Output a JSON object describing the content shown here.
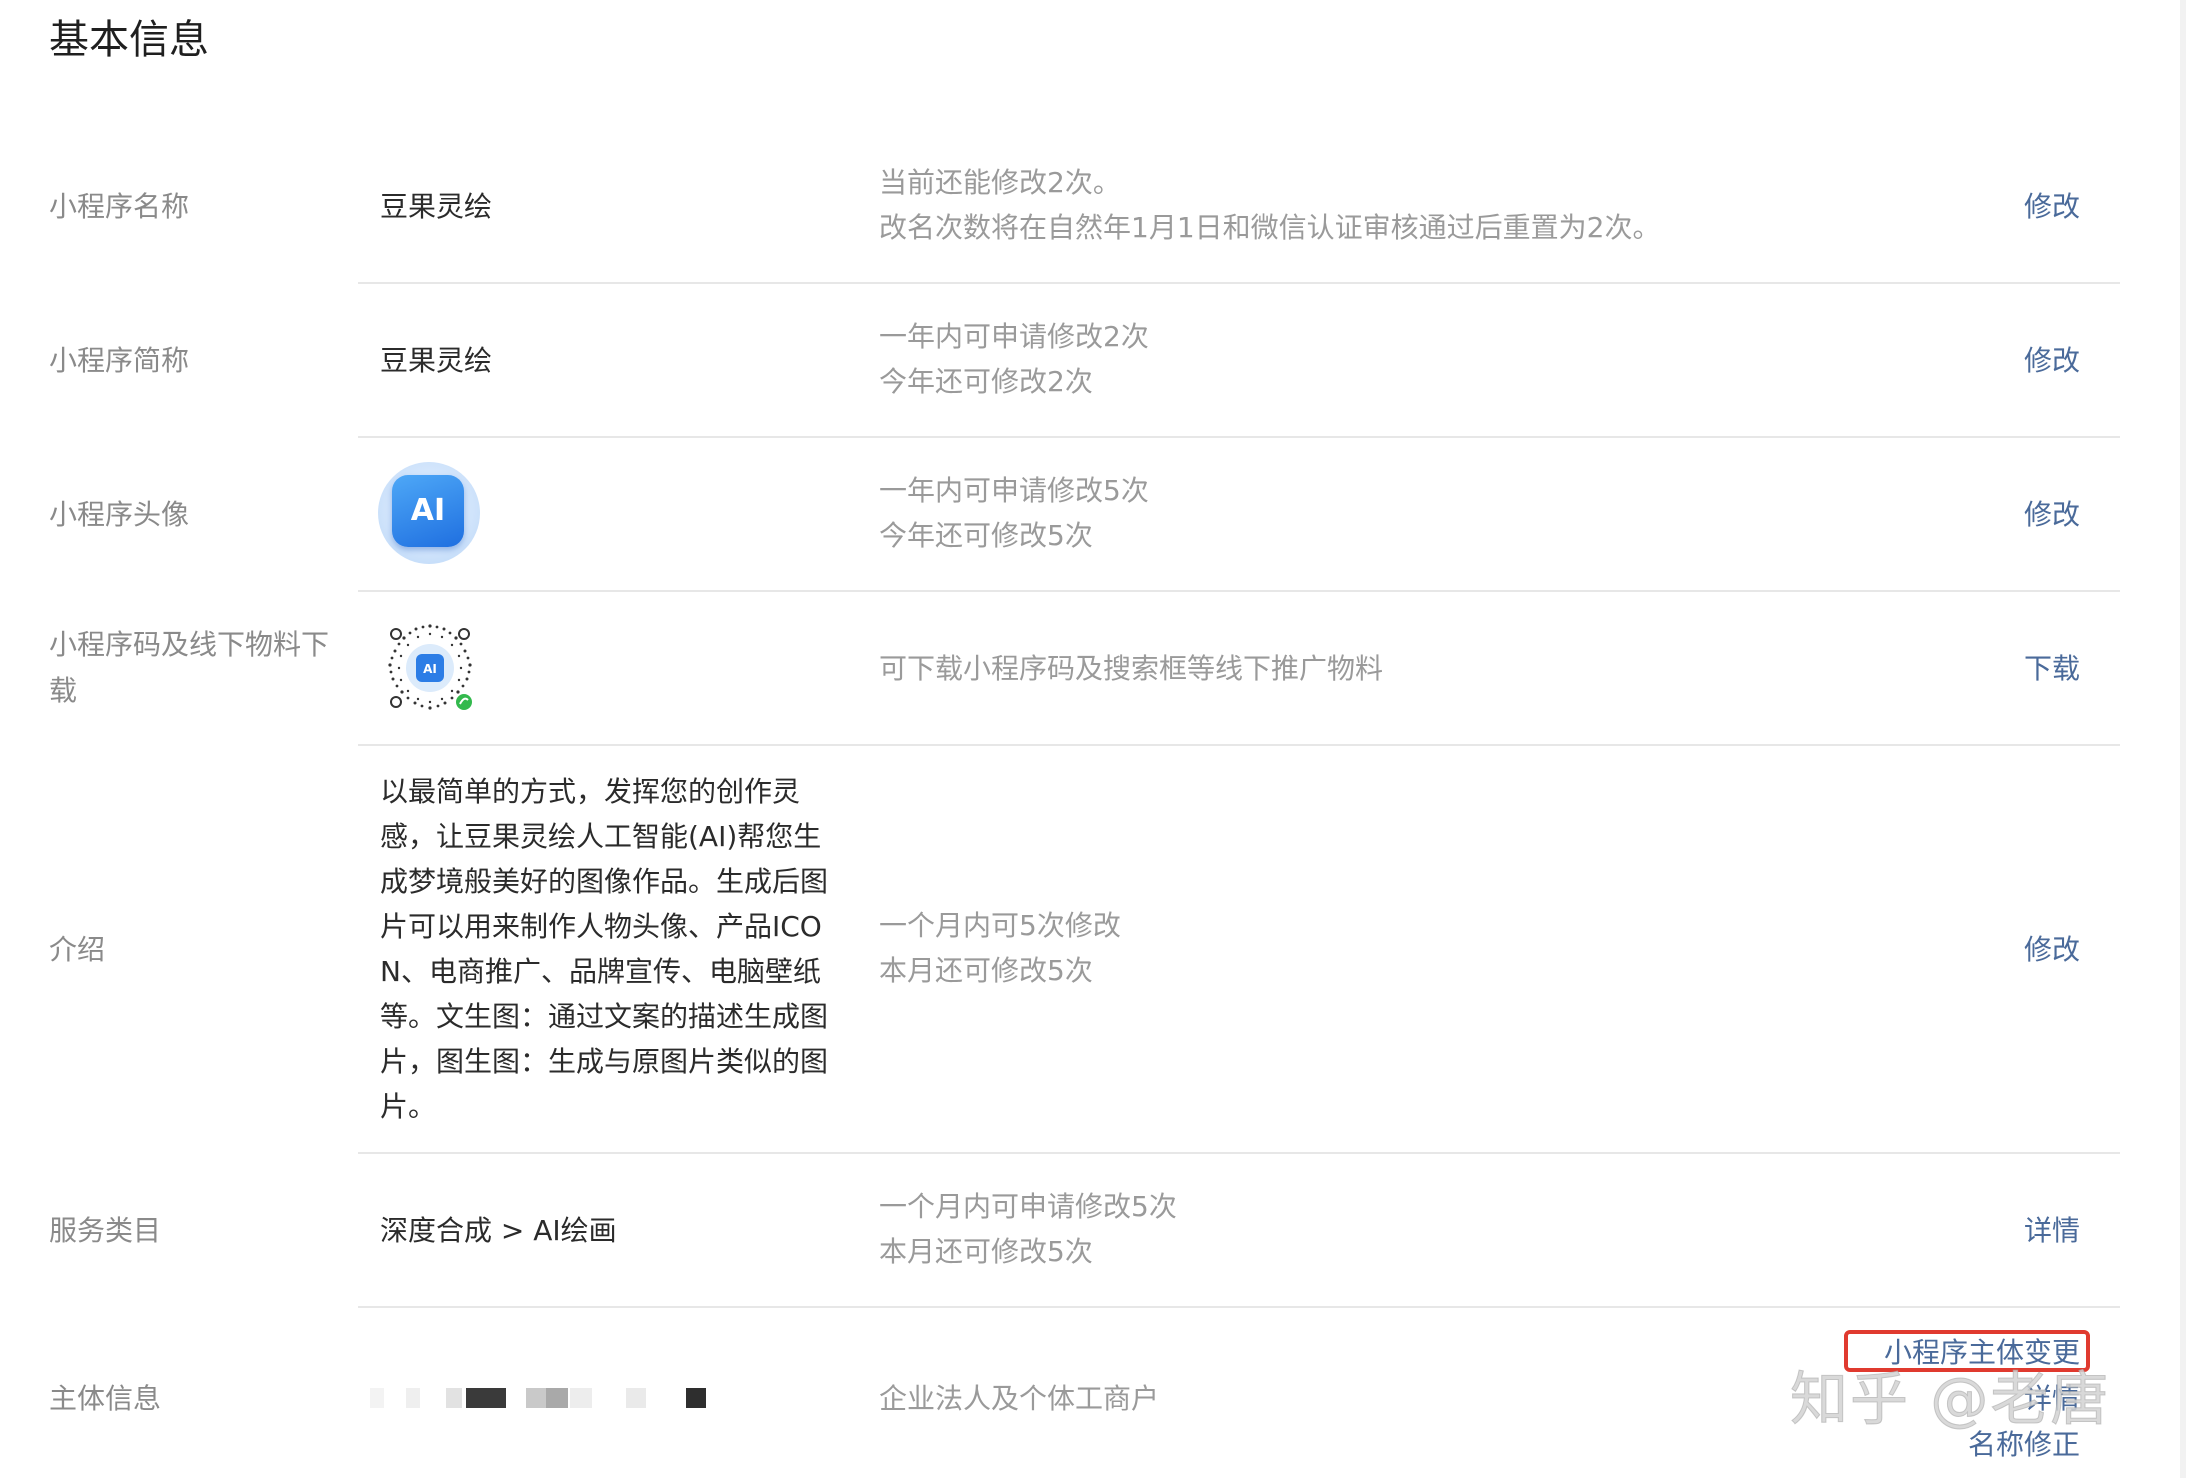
{
  "section_title": "基本信息",
  "rows": {
    "name": {
      "label": "小程序名称",
      "value": "豆果灵绘",
      "hint_1": "当前还能修改2次。",
      "hint_2": "改名次数将在自然年1月1日和微信认证审核通过后重置为2次。",
      "action": "修改"
    },
    "short_name": {
      "label": "小程序简称",
      "value": "豆果灵绘",
      "hint_1": "一年内可申请修改2次",
      "hint_2": "今年还可修改2次",
      "action": "修改"
    },
    "avatar": {
      "label": "小程序头像",
      "icon_text": "AI",
      "hint_1": "一年内可申请修改5次",
      "hint_2": "今年还可修改5次",
      "action": "修改"
    },
    "qrcode": {
      "label_1": "小程序码及线下物料下",
      "label_2": "载",
      "icon_text": "AI",
      "hint_1": "可下载小程序码及搜索框等线下推广物料",
      "action": "下载"
    },
    "intro": {
      "label": "介绍",
      "lines": [
        "以最简单的方式，发挥您的创作灵",
        "感，让豆果灵绘人工智能(AI)帮您生",
        "成梦境般美好的图像作品。生成后图",
        "片可以用来制作人物头像、产品ICO",
        "N、电商推广、品牌宣传、电脑壁纸",
        "等。文生图：通过文案的描述生成图",
        "片，图生图：生成与原图片类似的图",
        "片。"
      ],
      "hint_1": "一个月内可5次修改",
      "hint_2": "本月还可修改5次",
      "action": "修改"
    },
    "category": {
      "label": "服务类目",
      "value": "深度合成 > AI绘画",
      "hint_1": "一个月内可申请修改5次",
      "hint_2": "本月还可修改5次",
      "action": "详情"
    },
    "subject": {
      "label": "主体信息",
      "hint_1": "企业法人及个体工商户",
      "action_1": "小程序主体变更",
      "action_2": "详情",
      "action_3": "名称修正"
    }
  },
  "watermark": "知乎 @老唐",
  "colors": {
    "link": "#4a6a9a",
    "label": "#8a8a8a",
    "hint": "#9a9a9a",
    "highlight": "#e03a2f"
  }
}
